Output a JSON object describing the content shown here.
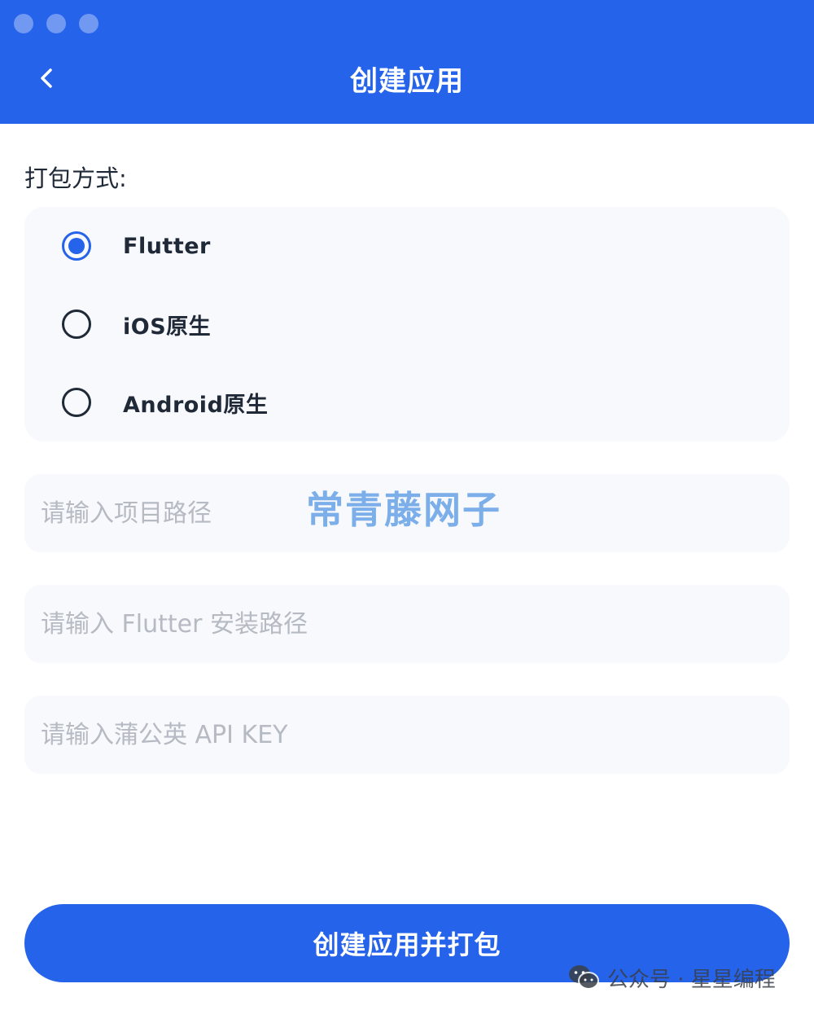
{
  "header": {
    "title": "创建应用",
    "back_icon": "chevron-left-icon",
    "color": "#2563eb"
  },
  "pack_section": {
    "label": "打包方式:",
    "options": [
      {
        "label": "Flutter",
        "checked": true
      },
      {
        "label": "iOS原生",
        "checked": false
      },
      {
        "label": "Android原生",
        "checked": false
      }
    ]
  },
  "inputs": {
    "project_path": {
      "value": "",
      "placeholder": "请输入项目路径"
    },
    "flutter_path": {
      "value": "",
      "placeholder": "请输入 Flutter 安装路径"
    },
    "pgyer_key": {
      "value": "",
      "placeholder": "请输入蒲公英 API KEY"
    }
  },
  "submit": {
    "label": "创建应用并打包"
  },
  "watermarks": {
    "top_text": "常青藤网子",
    "bottom_text": "公众号 · 星星编程",
    "bottom_icon": "wechat-icon"
  }
}
